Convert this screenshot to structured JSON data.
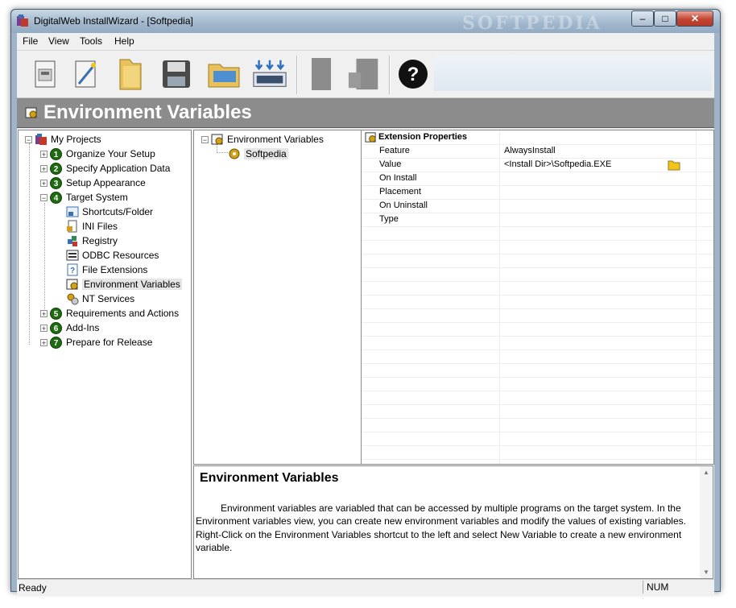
{
  "window": {
    "title": "DigitalWeb InstallWizard - [Softpedia]",
    "watermark": "SOFTPEDIA"
  },
  "menu": {
    "items": [
      "File",
      "View",
      "Tools",
      "Help"
    ]
  },
  "toolbar": {
    "buttons": [
      "new-project-icon",
      "wizard-wand-icon",
      "open-folder-icon",
      "save-disk-icon",
      "open-project-icon",
      "build-download-icon",
      "disabled-icon-1",
      "disabled-icon-2",
      "help-icon"
    ],
    "help_glyph": "?"
  },
  "header": {
    "title": "Environment Variables"
  },
  "tree": {
    "root": "My Projects",
    "steps": [
      {
        "num": "1",
        "label": "Organize Your Setup"
      },
      {
        "num": "2",
        "label": "Specify Application Data"
      },
      {
        "num": "3",
        "label": "Setup Appearance"
      },
      {
        "num": "4",
        "label": "Target System"
      },
      {
        "num": "5",
        "label": "Requirements and Actions"
      },
      {
        "num": "6",
        "label": "Add-Ins"
      },
      {
        "num": "7",
        "label": "Prepare for Release"
      }
    ],
    "target_children": [
      "Shortcuts/Folder",
      "INI Files",
      "Registry",
      "ODBC Resources",
      "File Extensions",
      "Environment Variables",
      "NT Services"
    ],
    "selected": "Environment Variables"
  },
  "middle": {
    "root": "Environment Variables",
    "child": "Softpedia"
  },
  "properties": {
    "heading": "Extension Properties",
    "rows": [
      {
        "name": "Feature",
        "value": "AlwaysInstall"
      },
      {
        "name": "Value",
        "value": "<Install Dir>\\Softpedia.EXE"
      },
      {
        "name": "On Install",
        "value": ""
      },
      {
        "name": "Placement",
        "value": ""
      },
      {
        "name": "On Uninstall",
        "value": ""
      },
      {
        "name": "Type",
        "value": ""
      }
    ]
  },
  "description": {
    "title": "Environment Variables",
    "body": "Environment variables are variabled that can be accessed by multiple programs on the target system. In the Environment variables view, you can create new environment variables and modify the values of existing variables. Right-Click on the Environment Variables shortcut to the left and select New Variable to create a new environment variable."
  },
  "status": {
    "text": "Ready",
    "num": "NUM"
  },
  "colors": {
    "header_bg": "#8c8c8c",
    "step_badge": "#1f6b12",
    "titlebar": "#9fb6cc",
    "close_button": "#c24431"
  }
}
